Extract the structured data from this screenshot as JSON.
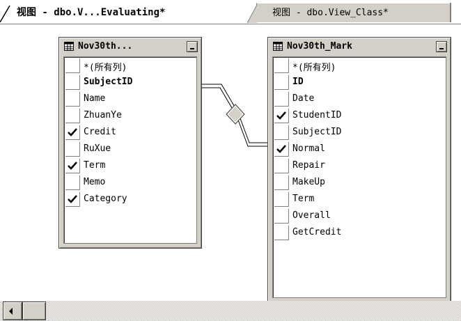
{
  "tabs": {
    "active_label": "视图 - dbo.V...Evaluating*",
    "inactive_label": "视图 - dbo.View_Class*"
  },
  "tables": [
    {
      "title": "Nov30th...",
      "columns": [
        {
          "label": "*(所有列)",
          "checked": false,
          "bold": false
        },
        {
          "label": "SubjectID",
          "checked": false,
          "bold": true
        },
        {
          "label": "Name",
          "checked": false,
          "bold": false
        },
        {
          "label": "ZhuanYe",
          "checked": false,
          "bold": false
        },
        {
          "label": "Credit",
          "checked": true,
          "bold": false
        },
        {
          "label": "RuXue",
          "checked": false,
          "bold": false
        },
        {
          "label": "Term",
          "checked": true,
          "bold": false
        },
        {
          "label": "Memo",
          "checked": false,
          "bold": false
        },
        {
          "label": "Category",
          "checked": true,
          "bold": false
        }
      ]
    },
    {
      "title": "Nov30th_Mark",
      "columns": [
        {
          "label": "*(所有列)",
          "checked": false,
          "bold": false
        },
        {
          "label": "ID",
          "checked": false,
          "bold": true
        },
        {
          "label": "Date",
          "checked": false,
          "bold": false
        },
        {
          "label": "StudentID",
          "checked": true,
          "bold": false
        },
        {
          "label": "SubjectID",
          "checked": false,
          "bold": false
        },
        {
          "label": "Normal",
          "checked": true,
          "bold": false
        },
        {
          "label": "Repair",
          "checked": false,
          "bold": false
        },
        {
          "label": "MakeUp",
          "checked": false,
          "bold": false
        },
        {
          "label": "Term",
          "checked": false,
          "bold": false
        },
        {
          "label": "Overall",
          "checked": false,
          "bold": false
        },
        {
          "label": "GetCredit",
          "checked": false,
          "bold": false
        }
      ]
    }
  ],
  "icons": {
    "table": "table-icon",
    "minimize": "minimize-icon",
    "check": "check-icon",
    "scroll_left": "arrow-left-icon"
  },
  "colors": {
    "face": "#d4d0c8",
    "canvas": "#ffffff"
  }
}
